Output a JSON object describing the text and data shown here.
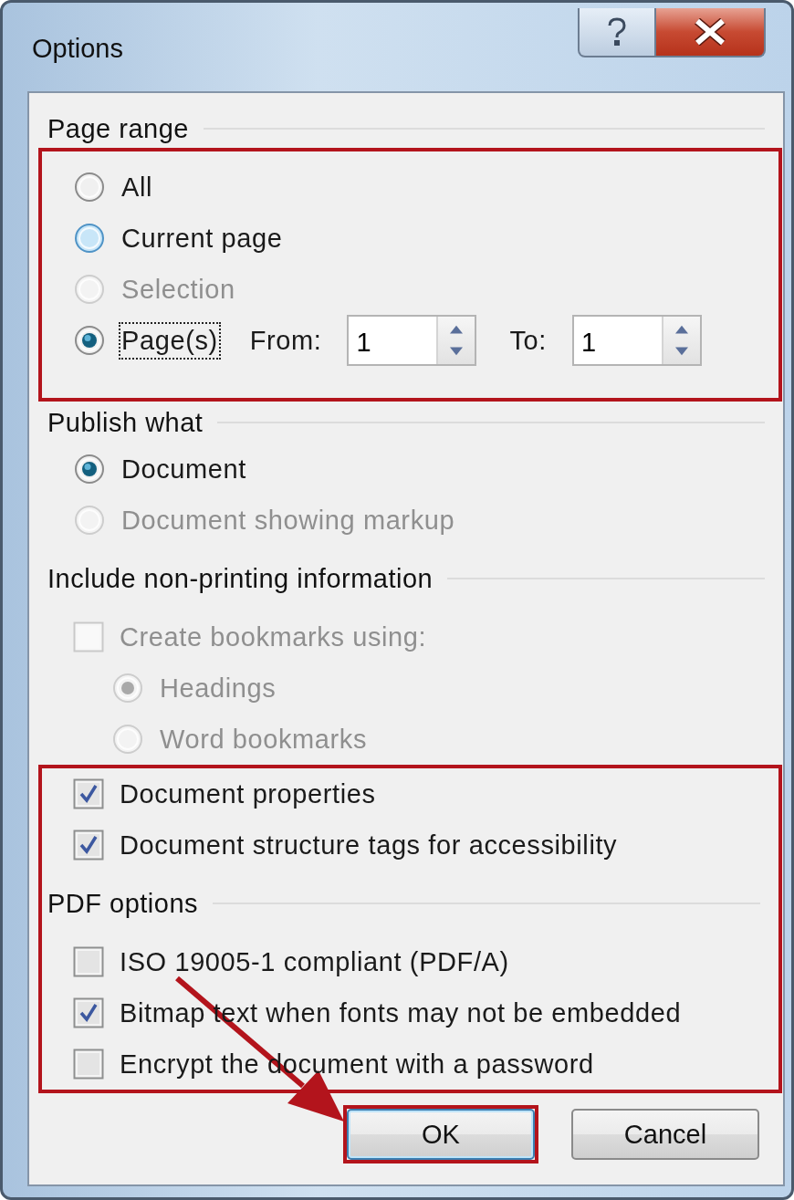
{
  "window": {
    "title": "Options"
  },
  "blocks": [
    {
      "kind": "heading",
      "text": "Page range"
    },
    {
      "kind": "frame",
      "rows": [
        {
          "kind": "radio",
          "label": "All",
          "selected": false,
          "disabled": false,
          "hovered": false,
          "focused": false
        },
        {
          "kind": "radio",
          "label": "Current page",
          "selected": false,
          "disabled": false,
          "hovered": true,
          "focused": false
        },
        {
          "kind": "radio",
          "label": "Selection",
          "selected": false,
          "disabled": true,
          "hovered": false,
          "focused": false
        },
        {
          "kind": "pages",
          "label": "Page(s)",
          "selected": true,
          "disabled": false,
          "hovered": false,
          "focused": true,
          "from": {
            "label": "From:",
            "value": "1"
          },
          "to": {
            "label": "To:",
            "value": "1"
          }
        }
      ]
    },
    {
      "kind": "heading",
      "text": "Publish what"
    },
    {
      "kind": "radio",
      "label": "Document",
      "selected": true,
      "disabled": false
    },
    {
      "kind": "radio",
      "label": "Document showing markup",
      "selected": false,
      "disabled": true
    },
    {
      "kind": "heading",
      "text": "Include non-printing information"
    },
    {
      "kind": "checkbox",
      "label": "Create bookmarks using:",
      "checked": false,
      "disabled": true,
      "children": [
        {
          "kind": "radio",
          "label": "Headings",
          "selected": true,
          "disabled": true
        },
        {
          "kind": "radio",
          "label": "Word bookmarks",
          "selected": false,
          "disabled": true
        }
      ]
    },
    {
      "kind": "frame",
      "rows": [
        {
          "kind": "checkbox",
          "label": "Document properties",
          "checked": true,
          "disabled": false
        },
        {
          "kind": "checkbox",
          "label": "Document structure tags for accessibility",
          "checked": true,
          "disabled": false
        },
        {
          "kind": "heading",
          "text": "PDF options"
        },
        {
          "kind": "checkbox",
          "label": "ISO 19005-1 compliant (PDF/A)",
          "checked": false,
          "disabled": false
        },
        {
          "kind": "checkbox",
          "label": "Bitmap text when fonts may not be embedded",
          "checked": true,
          "disabled": false
        },
        {
          "kind": "checkbox",
          "label": "Encrypt the document with a password",
          "checked": false,
          "disabled": false
        }
      ]
    }
  ],
  "buttons": [
    {
      "label": "OK",
      "default": true,
      "highlighted": true,
      "pointed_at": true
    },
    {
      "label": "Cancel",
      "default": false,
      "highlighted": false,
      "pointed_at": false
    }
  ]
}
